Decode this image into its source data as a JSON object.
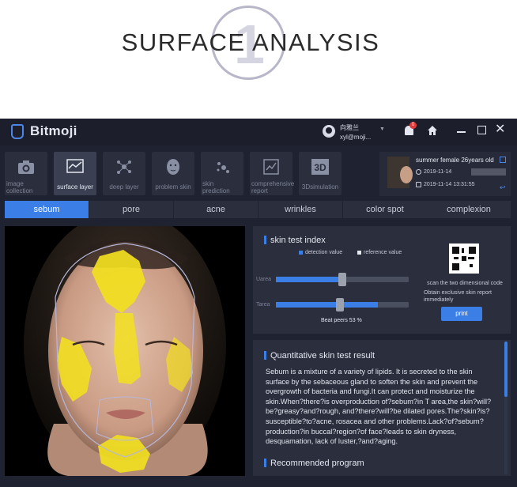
{
  "banner": {
    "digit": "1",
    "title": "SURFACE ANALYSIS"
  },
  "app": {
    "logo": "Bitmoji",
    "user": {
      "name": "向雅兰",
      "email": "xyl@moji...",
      "notification_count": "0"
    },
    "window_controls": {
      "close": "✕"
    }
  },
  "modules": [
    {
      "label": "image collection",
      "icon": "camera-icon",
      "active": false
    },
    {
      "label": "surface layer",
      "icon": "chart-icon",
      "active": true
    },
    {
      "label": "deep layer",
      "icon": "molecule-icon",
      "active": false
    },
    {
      "label": "problem skin",
      "icon": "face-icon",
      "active": false
    },
    {
      "label": "skin prediction",
      "icon": "dots-icon",
      "active": false
    },
    {
      "label": "comprehensive report",
      "icon": "report-icon",
      "active": false
    },
    {
      "label": "3Dsimulation",
      "icon": "3d-icon",
      "active": false
    }
  ],
  "patient": {
    "info": "summer   female   26years old",
    "date1": "2019-11-14",
    "date2": "2019-11-14 13:31:55"
  },
  "tabs": [
    {
      "label": "sebum",
      "active": true
    },
    {
      "label": "pore",
      "active": false
    },
    {
      "label": "acne",
      "active": false
    },
    {
      "label": "wrinkles",
      "active": false
    },
    {
      "label": "color spot",
      "active": false
    },
    {
      "label": "complexion",
      "active": false
    }
  ],
  "index": {
    "title": "skin test index",
    "legend_detection": "detection value",
    "legend_reference": "reference value",
    "rows": [
      {
        "label": "Uarea",
        "detection": 0.5
      },
      {
        "label": "Tarea",
        "detection": 0.77
      }
    ],
    "beat": "Beat peers  53  %",
    "scan": "scan the two dimensional code",
    "obtain": "Obtain exclusive skin report immediately",
    "print": "print"
  },
  "result": {
    "title": "Quantitative skin test result",
    "text": "Sebum is a mixture of a variety of lipids. It is secreted to the skin surface by the sebaceous gland to soften the skin and prevent the overgrowth of bacteria and fungi.It can protect and moisturize the skin.When?there?is overproduction of?sebum?in T area,the skin?will?be?greasy?and?rough, and?there?will?be dilated pores.The?skin?is?susceptible?to?acne, rosacea and other problems.Lack?of?sebum?production?in buccal?region?of face?leads to skin dryness, desquamation, lack of luster,?and?aging.",
    "recommend": "Recommended program"
  },
  "colors": {
    "accent": "#3b7ee6",
    "sebum": "#f2e01e"
  }
}
